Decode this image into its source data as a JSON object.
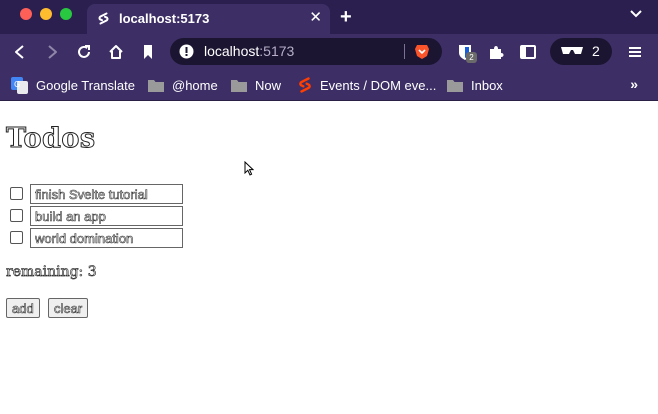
{
  "browser": {
    "tab": {
      "title": "localhost:5173"
    },
    "url": {
      "host": "localhost",
      "port": ":5173"
    },
    "wallet_count": "2",
    "extension_badge": "2",
    "bookmarks": [
      {
        "label": "Google Translate",
        "icon": "google-translate-icon"
      },
      {
        "label": "@home",
        "icon": "folder-icon"
      },
      {
        "label": "Now",
        "icon": "folder-icon"
      },
      {
        "label": "Events / DOM eve...",
        "icon": "svelte-icon"
      },
      {
        "label": "Inbox",
        "icon": "folder-icon"
      }
    ]
  },
  "app": {
    "title": "Todos",
    "todos": [
      {
        "text": "finish Svelte tutorial",
        "done": false
      },
      {
        "text": "build an app",
        "done": false
      },
      {
        "text": "world domination",
        "done": false
      }
    ],
    "remaining_label": "remaining: 3",
    "add_label": "add",
    "clear_label": "clear"
  },
  "colors": {
    "chrome_bg": "#3d2f66",
    "tabbar_bg": "#2b1f4f",
    "urlbar_bg": "#1c1531"
  }
}
